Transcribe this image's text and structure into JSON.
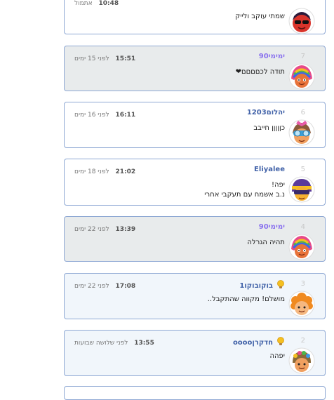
{
  "comments": [
    {
      "number": "",
      "username": "",
      "time": "10:48",
      "date": "אתמול",
      "message_lines": [
        "שמתי עוקב ולייק"
      ],
      "avatar": "avatar-red-dark-hair-sunglasses",
      "background": "white"
    },
    {
      "number": "7",
      "username": "ימימי90",
      "time": "15:51",
      "date": "לפני 15 ימים",
      "message_lines": [
        "תודה לכםםםם❤"
      ],
      "avatar": "avatar-rainbow-hair",
      "background": "gray"
    },
    {
      "number": "6",
      "username": "יהלום1203",
      "time": "16:11",
      "date": "לפני 16 ימים",
      "message_lines": [
        "כןןןןן חייבב"
      ],
      "avatar": "avatar-goggles-pink-bow",
      "background": "white"
    },
    {
      "number": "5",
      "username": "Eliyalee",
      "time": "21:02",
      "date": "לפני 18 ימים",
      "message_lines": [
        "יפה!",
        "נ.ב אשמח עם תעקבי אחרי"
      ],
      "avatar": "avatar-purple-helmet",
      "background": "white"
    },
    {
      "number": "4",
      "username": "ימימי90",
      "time": "13:39",
      "date": "לפני 22 ימים",
      "message_lines": [
        "תהיה הגרלה"
      ],
      "avatar": "avatar-rainbow-hair",
      "background": "gray"
    },
    {
      "number": "3",
      "username": "בוקובוקו1",
      "time": "17:08",
      "date": "לפני 22 ימים",
      "message_lines": [
        "מושלם! מקווה שהתקבל.."
      ],
      "avatar": "avatar-orange-curly-hair",
      "has_bulb": true,
      "background": "blue"
    },
    {
      "number": "2",
      "username": "חדקרןoooo",
      "time": "13:55",
      "date": "לפני שלושה שבועות",
      "message_lines": [
        "יפהה"
      ],
      "avatar": "avatar-flower-crown",
      "has_bulb": true,
      "background": "blue"
    }
  ]
}
